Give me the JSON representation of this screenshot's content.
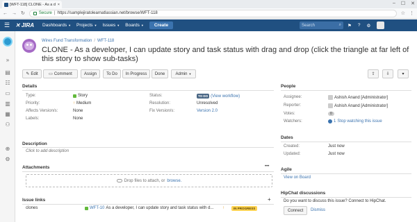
{
  "browser": {
    "tab_title": "[WFT-118] CLONE - As a d",
    "tab_close": "×",
    "secure_label": "Secure",
    "url": "https://samplejiratolearnatlassian.net/browse/WFT-118",
    "win_min": "–",
    "win_max": "☐",
    "win_close": "✕"
  },
  "nav": {
    "brand": "JIRA",
    "menus": [
      "Dashboards",
      "Projects",
      "Issues",
      "Boards"
    ],
    "create_label": "Create",
    "search_placeholder": "Search"
  },
  "issue": {
    "breadcrumb_project": "Wires Fund Transformation",
    "breadcrumb_sep": "/",
    "breadcrumb_key": "WFT-118",
    "title": "CLONE - As a developer, I can update story and task status with drag and drop (click the triangle at far left of this story to show sub-tasks)"
  },
  "toolbar": {
    "edit": "Edit",
    "comment": "Comment",
    "assign": "Assign",
    "to_do": "To Do",
    "in_progress": "In Progress",
    "done": "Done",
    "admin": "Admin"
  },
  "details": {
    "heading": "Details",
    "type_label": "Type:",
    "type_value": "Story",
    "priority_label": "Priority:",
    "priority_value": "Medium",
    "affects_label": "Affects Version/s:",
    "affects_value": "None",
    "labels_label": "Labels:",
    "labels_value": "None",
    "status_label": "Status:",
    "status_value": "TO DO",
    "status_link": "(View workflow)",
    "resolution_label": "Resolution:",
    "resolution_value": "Unresolved",
    "fix_label": "Fix Version/s:",
    "fix_value": "Version 2.0"
  },
  "description": {
    "heading": "Description",
    "placeholder": "Click to add description"
  },
  "attachments": {
    "heading": "Attachments",
    "more": "•••",
    "drop_text": "Drop files to attach, or",
    "browse": "browse."
  },
  "issue_links": {
    "heading": "Issue links",
    "add": "+",
    "relation": "clones",
    "linked_key": "WFT-10",
    "linked_summary": "As a developer, I can update story and task status with d...",
    "linked_status": "IN PROGRESS"
  },
  "people": {
    "heading": "People",
    "assignee_label": "Assignee:",
    "assignee_value": "Ashish Anand [Administrator]",
    "reporter_label": "Reporter:",
    "reporter_value": "Ashish Anand [Administrator]",
    "votes_label": "Votes:",
    "votes_value": "0",
    "watchers_label": "Watchers:",
    "watchers_value": "1",
    "watch_link": "Stop watching this issue"
  },
  "dates": {
    "heading": "Dates",
    "created_label": "Created:",
    "created_value": "Just now",
    "updated_label": "Updated:",
    "updated_value": "Just now"
  },
  "agile": {
    "heading": "Agile",
    "link": "View on Board"
  },
  "hipchat": {
    "heading": "HipChat discussions",
    "question": "Do you want to discuss this issue? Connect to HipChat.",
    "connect": "Connect",
    "dismiss": "Dismiss"
  },
  "colors": {
    "nav_bg": "#205081",
    "link": "#3b73af",
    "story_green": "#63ba3c",
    "todo_badge": "#4a6785",
    "inprogress_badge": "#ffd351"
  },
  "icons": {
    "nav": [
      "menu-icon",
      "jira-logo-icon",
      "help-icon",
      "settings-icon",
      "notifications-icon"
    ],
    "toolbar": [
      "pencil-icon",
      "comment-icon",
      "share-icon",
      "export-icon",
      "more-icon"
    ],
    "sidebar": [
      "board-icon",
      "backlog-icon",
      "releases-icon",
      "reports-icon",
      "issues-icon",
      "components-icon",
      "add-item-icon",
      "project-settings-icon"
    ]
  }
}
